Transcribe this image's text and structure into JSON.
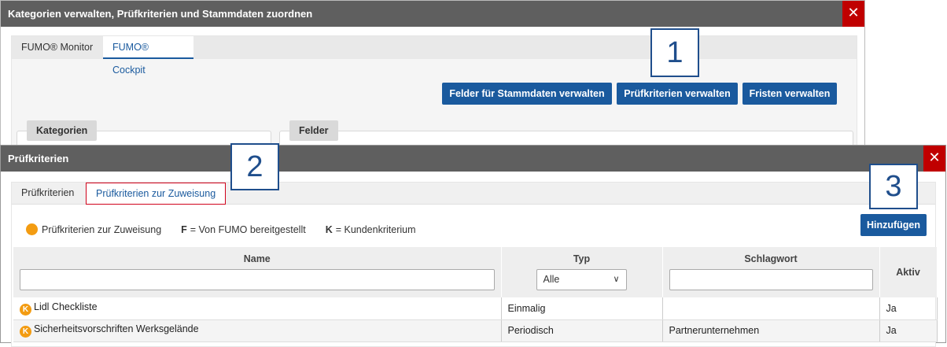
{
  "back_dialog": {
    "title": "Kategorien verwalten, Prüfkriterien und Stammdaten zuordnen",
    "close_label": "✕",
    "tabs": [
      "FUMO® Monitor",
      "FUMO® Cockpit"
    ],
    "buttons": {
      "felder": "Felder für Stammdaten verwalten",
      "pruefkriterien": "Prüfkriterien verwalten",
      "fristen": "Fristen verwalten"
    },
    "sections": {
      "kategorien": "Kategorien",
      "felder": "Felder"
    }
  },
  "front_dialog": {
    "title": "Prüfkriterien",
    "close_label": "✕",
    "tabs": [
      "Prüfkriterien",
      "Prüfkriterien zur Zuweisung"
    ],
    "add_button": "Hinzufügen",
    "legend": {
      "assignment": "Prüfkriterien zur Zuweisung",
      "f_key": "F",
      "f_text": "= Von FUMO bereitgestellt",
      "k_key": "K",
      "k_text": "= Kundenkriterium"
    },
    "table": {
      "columns": [
        "Name",
        "Typ",
        "Schlagwort",
        "Aktiv"
      ],
      "typ_filter_value": "Alle",
      "rows": [
        {
          "badge": "K",
          "name": "Lidl Checkliste",
          "typ": "Einmalig",
          "schlagwort": "",
          "aktiv": "Ja"
        },
        {
          "badge": "K",
          "name": "Sicherheitsvorschriften Werksgelände",
          "typ": "Periodisch",
          "schlagwort": "Partnerunternehmen",
          "aktiv": "Ja"
        }
      ]
    }
  },
  "callouts": [
    "1",
    "2",
    "3"
  ],
  "colors": {
    "titlebar": "#5f5f5f",
    "close": "#c00000",
    "primary": "#1a5a9e",
    "callout": "#1f4e8c",
    "badge": "#f39c12"
  }
}
